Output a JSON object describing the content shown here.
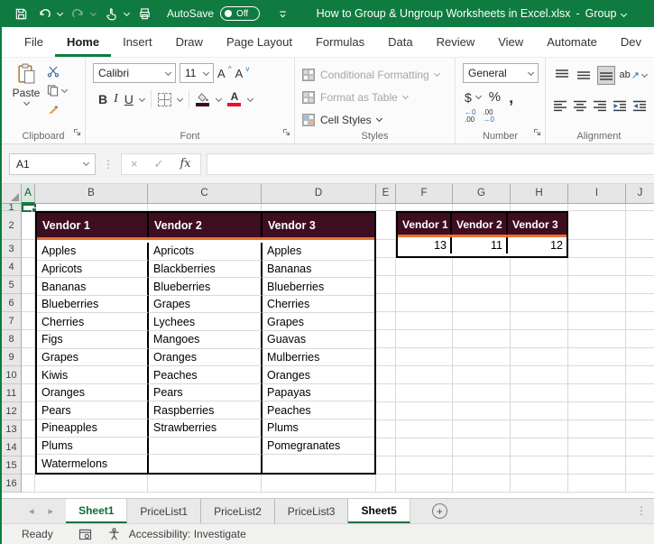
{
  "titlebar": {
    "autosave_label": "AutoSave",
    "autosave_state": "Off",
    "doc_title": "How to Group & Ungroup Worksheets in Excel.xlsx",
    "separator": "-",
    "group_indicator": "Group"
  },
  "ribbon_tabs": [
    {
      "label": "File"
    },
    {
      "label": "Home",
      "active": true
    },
    {
      "label": "Insert"
    },
    {
      "label": "Draw"
    },
    {
      "label": "Page Layout"
    },
    {
      "label": "Formulas"
    },
    {
      "label": "Data"
    },
    {
      "label": "Review"
    },
    {
      "label": "View"
    },
    {
      "label": "Automate"
    },
    {
      "label": "Dev"
    }
  ],
  "ribbon": {
    "clipboard": {
      "group_label": "Clipboard",
      "paste_label": "Paste"
    },
    "font": {
      "group_label": "Font",
      "font_name": "Calibri",
      "font_size": "11",
      "bold": "B",
      "italic": "I",
      "underline": "U",
      "grow_font": "A",
      "shrink_font": "A",
      "font_color_letter": "A"
    },
    "styles": {
      "group_label": "Styles",
      "conditional_formatting": "Conditional Formatting",
      "format_as_table": "Format as Table",
      "cell_styles": "Cell Styles"
    },
    "number": {
      "group_label": "Number",
      "format": "General",
      "currency": "$",
      "percent": "%",
      "comma": ",",
      "inc_dec_top": "←0",
      "inc_dec_bottom": ".00",
      "dec_dec_top": ".00",
      "dec_dec_bottom": "→0"
    },
    "alignment": {
      "group_label": "Alignment",
      "orientation_text": "ab",
      "orientation_arrow": "↗"
    }
  },
  "formula_bar": {
    "name_box": "A1",
    "cancel_glyph": "×",
    "enter_glyph": "✓",
    "fx_label": "fx",
    "formula_value": "",
    "dots_glyph": "⋮"
  },
  "grid": {
    "active_cell": "A1",
    "visible_columns": [
      "A",
      "B",
      "C",
      "D",
      "E",
      "F",
      "G",
      "H",
      "I",
      "J"
    ],
    "visible_rows": [
      "1",
      "2",
      "3",
      "4",
      "5",
      "6",
      "7",
      "8",
      "9",
      "10",
      "11",
      "12",
      "13",
      "14",
      "15",
      "16"
    ],
    "fruit_table": {
      "headers": [
        "Vendor 1",
        "Vendor 2",
        "Vendor 3"
      ],
      "rows": [
        [
          "Apples",
          "Apricots",
          "Apples"
        ],
        [
          "Apricots",
          "Blackberries",
          "Bananas"
        ],
        [
          "Bananas",
          "Blueberries",
          "Blueberries"
        ],
        [
          "Blueberries",
          "Grapes",
          "Cherries"
        ],
        [
          "Cherries",
          "Lychees",
          "Grapes"
        ],
        [
          "Figs",
          "Mangoes",
          "Guavas"
        ],
        [
          "Grapes",
          "Oranges",
          "Mulberries"
        ],
        [
          "Kiwis",
          "Peaches",
          "Oranges"
        ],
        [
          "Oranges",
          "Pears",
          "Papayas"
        ],
        [
          "Pears",
          "Raspberries",
          "Peaches"
        ],
        [
          "Pineapples",
          "Strawberries",
          "Plums"
        ],
        [
          "Plums",
          "",
          "Pomegranates"
        ],
        [
          "Watermelons",
          "",
          ""
        ]
      ]
    },
    "count_table": {
      "headers": [
        "Vendor 1",
        "Vendor 2",
        "Vendor 3"
      ],
      "values": [
        "13",
        "11",
        "12"
      ]
    }
  },
  "sheet_tabs": {
    "nav_left_glyph": "◂",
    "nav_right_glyph": "▸",
    "add_glyph": "+",
    "grip_glyph": "⋮",
    "tabs": [
      {
        "label": "Sheet1",
        "state": "active"
      },
      {
        "label": "PriceList1",
        "state": "normal"
      },
      {
        "label": "PriceList2",
        "state": "normal"
      },
      {
        "label": "PriceList3",
        "state": "normal"
      },
      {
        "label": "Sheet5",
        "state": "grouped"
      }
    ]
  },
  "status_bar": {
    "mode": "Ready",
    "accessibility": "Accessibility: Investigate"
  },
  "colors": {
    "excel_green": "#0F7B40",
    "table_header_fill": "#3F0D20",
    "table_header_accent_border": "#E97132",
    "font_color_swatch": "#E8112D",
    "fill_color_swatch": "#3F0D20"
  },
  "icons": [
    "save-icon",
    "undo-icon",
    "redo-icon",
    "touch-mode-icon",
    "print-preview-icon",
    "ribbon-options-icon",
    "paste-icon",
    "cut-icon",
    "copy-icon",
    "format-painter-icon",
    "borders-icon",
    "fill-color-icon",
    "font-color-icon",
    "conditional-formatting-icon",
    "format-as-table-icon",
    "cell-styles-icon",
    "align-top-icon",
    "align-middle-icon",
    "align-bottom-icon",
    "orientation-icon",
    "align-left-icon",
    "align-center-icon",
    "align-right-icon",
    "decrease-indent-icon",
    "increase-indent-icon",
    "select-all-icon",
    "macro-record-icon",
    "accessibility-icon"
  ]
}
